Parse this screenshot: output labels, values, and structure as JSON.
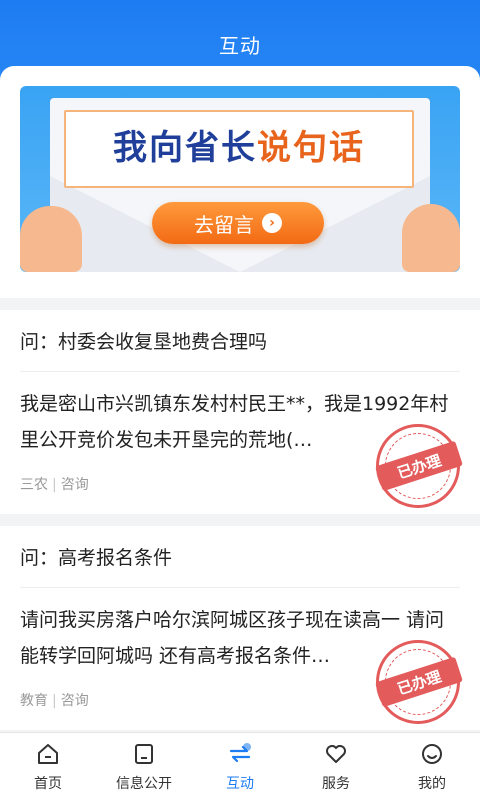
{
  "header": {
    "title": "互动"
  },
  "banner": {
    "slogan_part1": "我向省长",
    "slogan_part2": "说句话",
    "button_label": "去留言"
  },
  "questions": [
    {
      "question": "问：村委会收复垦地费合理吗",
      "answer": "我是密山市兴凯镇东发村村民王**，我是1992年村里公开竞价发包未开垦完的荒地(…",
      "category": "三农",
      "type": "咨询",
      "stamp": "已办理"
    },
    {
      "question": "问：高考报名条件",
      "answer": "请问我买房落户哈尔滨阿城区孩子现在读高一 请问能转学回阿城吗 还有高考报名条件…",
      "category": "教育",
      "type": "咨询",
      "stamp": "已办理"
    }
  ],
  "tabbar": {
    "items": [
      {
        "label": "首页",
        "icon": "home-icon"
      },
      {
        "label": "信息公开",
        "icon": "document-icon"
      },
      {
        "label": "互动",
        "icon": "interaction-icon"
      },
      {
        "label": "服务",
        "icon": "heart-icon"
      },
      {
        "label": "我的",
        "icon": "profile-icon"
      }
    ],
    "active": "互动"
  },
  "colors": {
    "primary": "#1e7cf2",
    "accent": "#f26a14",
    "stamp": "#e04a4a"
  }
}
